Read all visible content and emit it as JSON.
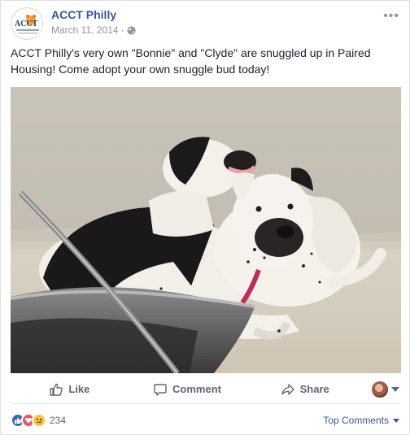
{
  "post": {
    "page_name": "ACCT Philly",
    "date": "March 11, 2014",
    "separator": "·",
    "privacy_icon": "globe-icon",
    "more_icon": "more-icon",
    "caption": "ACCT Philly's very own \"Bonnie\" and \"Clyde\" are snuggled up in Paired Housing! Come adopt your own snuggle bud today!",
    "avatar_text": "ACCT",
    "avatar_subtext": "Animal Care & Control Team"
  },
  "actions": {
    "like_label": "Like",
    "comment_label": "Comment",
    "share_label": "Share"
  },
  "footer": {
    "reaction_count": "234",
    "top_comments_label": "Top Comments"
  },
  "colors": {
    "link": "#365899",
    "like_blue": "#4267b2",
    "love_red": "#f25268",
    "sad_yellow": "#f7c440"
  }
}
